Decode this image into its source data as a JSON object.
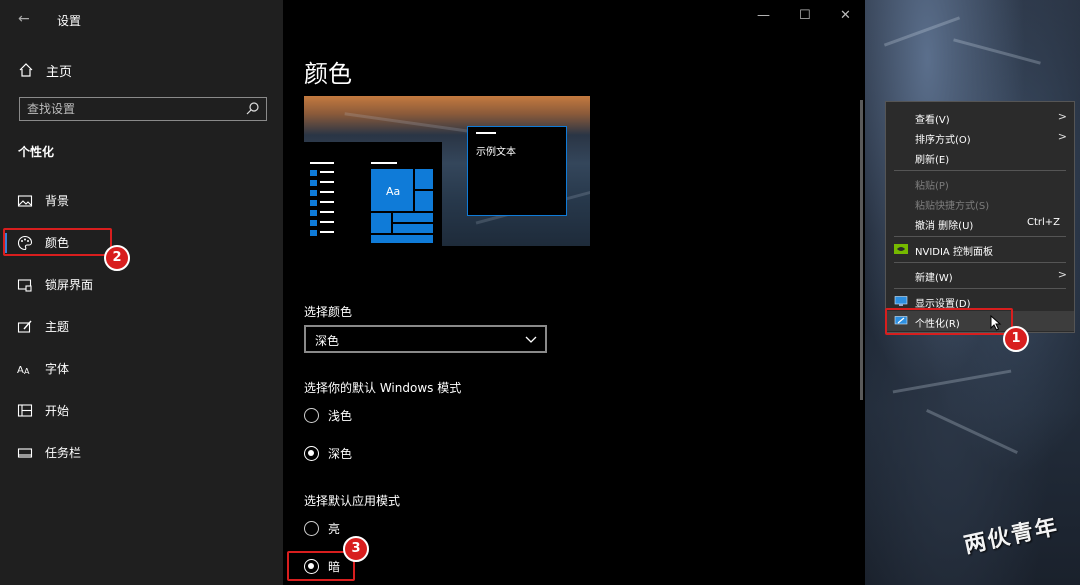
{
  "window": {
    "title": "设置",
    "controls": {
      "minimize": "—",
      "maximize": "☐",
      "close": "✕"
    }
  },
  "sidebar": {
    "home_label": "主页",
    "search_placeholder": "查找设置",
    "section_title": "个性化",
    "items": [
      {
        "label": "背景",
        "icon": "image-icon"
      },
      {
        "label": "颜色",
        "icon": "palette-icon",
        "active": true
      },
      {
        "label": "锁屏界面",
        "icon": "lock-screen-icon"
      },
      {
        "label": "主题",
        "icon": "brush-icon"
      },
      {
        "label": "字体",
        "icon": "font-icon"
      },
      {
        "label": "开始",
        "icon": "start-icon"
      },
      {
        "label": "任务栏",
        "icon": "taskbar-icon"
      }
    ]
  },
  "main": {
    "title": "颜色",
    "preview": {
      "sample_text": "示例文本",
      "tile_label": "Aa"
    },
    "choose_color_label": "选择颜色",
    "choose_color_value": "深色",
    "windows_mode_label": "选择你的默认 Windows 模式",
    "windows_mode_options": [
      {
        "label": "浅色",
        "selected": false
      },
      {
        "label": "深色",
        "selected": true
      }
    ],
    "app_mode_label": "选择默认应用模式",
    "app_mode_options": [
      {
        "label": "亮",
        "selected": false
      },
      {
        "label": "暗",
        "selected": true
      }
    ]
  },
  "context_menu": {
    "items": [
      {
        "label": "查看(V)",
        "submenu": true
      },
      {
        "label": "排序方式(O)",
        "submenu": true
      },
      {
        "label": "刷新(E)"
      },
      {
        "label": "粘贴(P)",
        "disabled": true
      },
      {
        "label": "粘贴快捷方式(S)",
        "disabled": true
      },
      {
        "label": "撤消 删除(U)",
        "shortcut": "Ctrl+Z"
      },
      {
        "label": "NVIDIA 控制面板",
        "icon": "nvidia-icon"
      },
      {
        "label": "新建(W)",
        "submenu": true
      },
      {
        "label": "显示设置(D)",
        "icon": "display-icon"
      },
      {
        "label": "个性化(R)",
        "icon": "personalize-icon"
      }
    ]
  },
  "annotations": {
    "step1": "1",
    "step2": "2",
    "step3": "3"
  },
  "watermark": "两伙青年",
  "colors": {
    "accent": "#0f7bd8",
    "highlight_red": "#d81e1e",
    "sidebar_bg": "#1f1f1f"
  }
}
